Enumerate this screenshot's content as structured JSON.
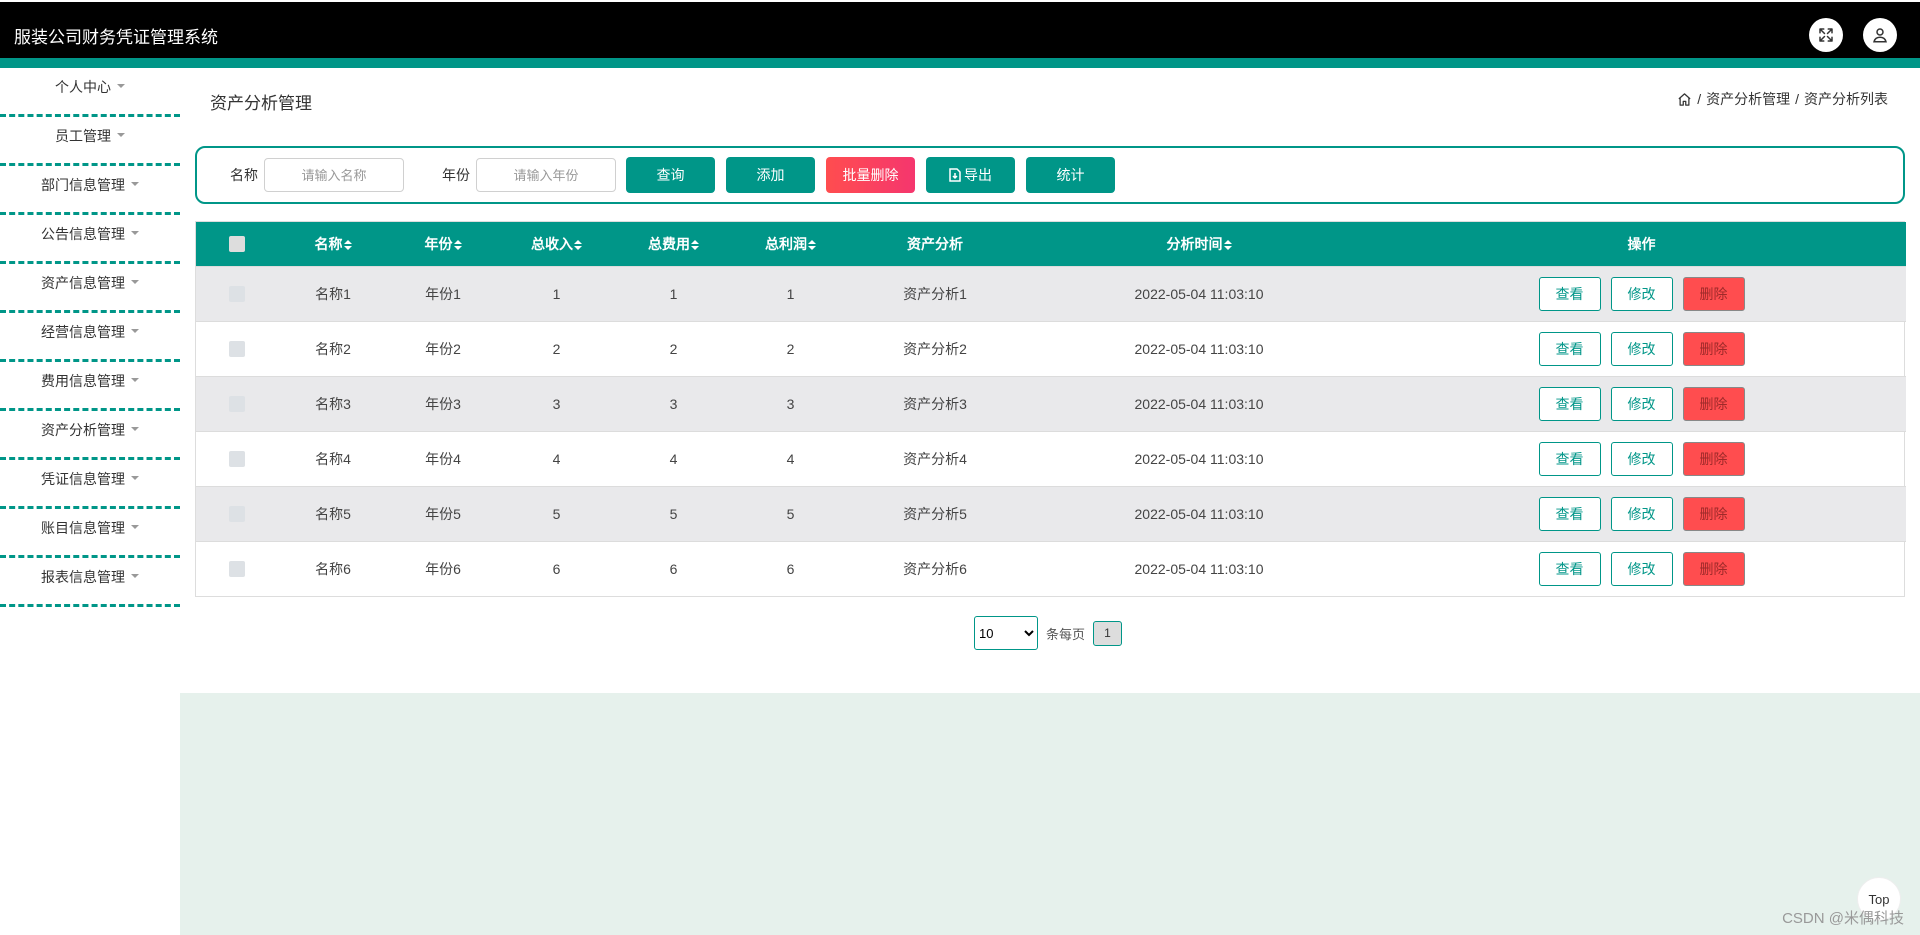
{
  "header": {
    "title": "服装公司财务凭证管理系统"
  },
  "sidebar": {
    "items": [
      {
        "label": "个人中心"
      },
      {
        "label": "员工管理"
      },
      {
        "label": "部门信息管理"
      },
      {
        "label": "公告信息管理"
      },
      {
        "label": "资产信息管理"
      },
      {
        "label": "经营信息管理"
      },
      {
        "label": "费用信息管理"
      },
      {
        "label": "资产分析管理"
      },
      {
        "label": "凭证信息管理"
      },
      {
        "label": "账目信息管理"
      },
      {
        "label": "报表信息管理"
      }
    ]
  },
  "main": {
    "title": "资产分析管理",
    "breadcrumb": [
      "资产分析管理",
      "资产分析列表"
    ],
    "breadcrumb_sep": "/"
  },
  "search": {
    "name_label": "名称",
    "name_placeholder": "请输入名称",
    "year_label": "年份",
    "year_placeholder": "请输入年份",
    "query_btn": "查询",
    "add_btn": "添加",
    "batch_delete_btn": "批量删除",
    "export_btn": "导出",
    "stats_btn": "统计"
  },
  "table": {
    "headers": [
      "名称",
      "年份",
      "总收入",
      "总费用",
      "总利润",
      "资产分析",
      "分析时间",
      "操作"
    ],
    "actions": {
      "view": "查看",
      "edit": "修改",
      "delete": "删除"
    },
    "rows": [
      {
        "name": "名称1",
        "year": "年份1",
        "income": "1",
        "cost": "1",
        "profit": "1",
        "analysis": "资产分析1",
        "time": "2022-05-04 11:03:10"
      },
      {
        "name": "名称2",
        "year": "年份2",
        "income": "2",
        "cost": "2",
        "profit": "2",
        "analysis": "资产分析2",
        "time": "2022-05-04 11:03:10"
      },
      {
        "name": "名称3",
        "year": "年份3",
        "income": "3",
        "cost": "3",
        "profit": "3",
        "analysis": "资产分析3",
        "time": "2022-05-04 11:03:10"
      },
      {
        "name": "名称4",
        "year": "年份4",
        "income": "4",
        "cost": "4",
        "profit": "4",
        "analysis": "资产分析4",
        "time": "2022-05-04 11:03:10"
      },
      {
        "name": "名称5",
        "year": "年份5",
        "income": "5",
        "cost": "5",
        "profit": "5",
        "analysis": "资产分析5",
        "time": "2022-05-04 11:03:10"
      },
      {
        "name": "名称6",
        "year": "年份6",
        "income": "6",
        "cost": "6",
        "profit": "6",
        "analysis": "资产分析6",
        "time": "2022-05-04 11:03:10"
      }
    ]
  },
  "pager": {
    "page_size": "10",
    "per_page_label": "条每页",
    "current_page": "1"
  },
  "top_btn": "Top",
  "watermark": "CSDN @米偶科技",
  "colors": {
    "accent": "#009688",
    "danger": "#ff4d4f",
    "header_bg": "#000000",
    "row_alt": "#e9e9eb"
  }
}
